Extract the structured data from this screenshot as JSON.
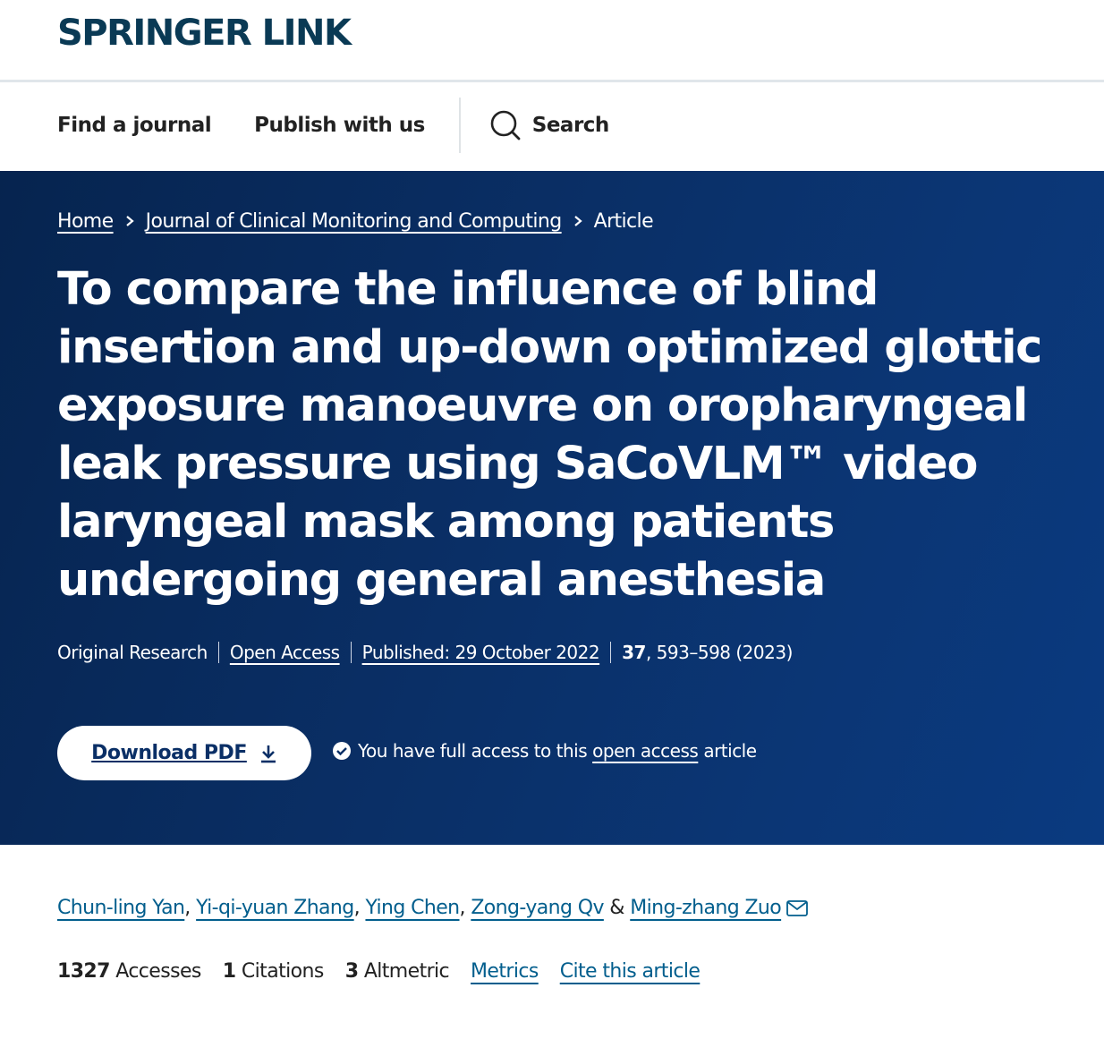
{
  "header": {
    "logo": "SPRINGER LINK"
  },
  "nav": {
    "find_journal": "Find a journal",
    "publish": "Publish with us",
    "search": "Search"
  },
  "breadcrumb": {
    "home": "Home",
    "journal": "Journal of Clinical Monitoring and Computing",
    "current": "Article"
  },
  "article": {
    "title": "To compare the influence of blind insertion and up-down optimized glottic exposure manoeuvre on oropharyngeal leak pressure using SaCoVLM™ video laryngeal mask among patients undergoing general anesthesia",
    "type": "Original Research",
    "access": "Open Access",
    "published": "Published: 29 October 2022",
    "volume": "37",
    "pages": ", 593–598 (2023)"
  },
  "actions": {
    "download_label": "Download PDF",
    "access_prefix": "You have full access to this",
    "access_link": "open access",
    "access_suffix": "article"
  },
  "authors": {
    "list": [
      "Chun-ling Yan",
      "Yi-qi-yuan Zhang",
      "Ying Chen",
      "Zong-yang Qv",
      "Ming-zhang Zuo"
    ],
    "comma": ",",
    "amp": "&"
  },
  "stats": {
    "accesses_count": "1327",
    "accesses_label": "Accesses",
    "citations_count": "1",
    "citations_label": "Citations",
    "altmetric_count": "3",
    "altmetric_label": "Altmetric",
    "metrics_link": "Metrics",
    "cite_link": "Cite this article"
  },
  "icons": {
    "search": "search-icon",
    "download": "download-icon",
    "check": "check-circle-icon",
    "mail": "mail-icon",
    "chevron": "chevron-right-icon"
  },
  "colors": {
    "brand": "#0a3a55",
    "hero_bg": "#0a2f66",
    "link": "#025e8d"
  }
}
